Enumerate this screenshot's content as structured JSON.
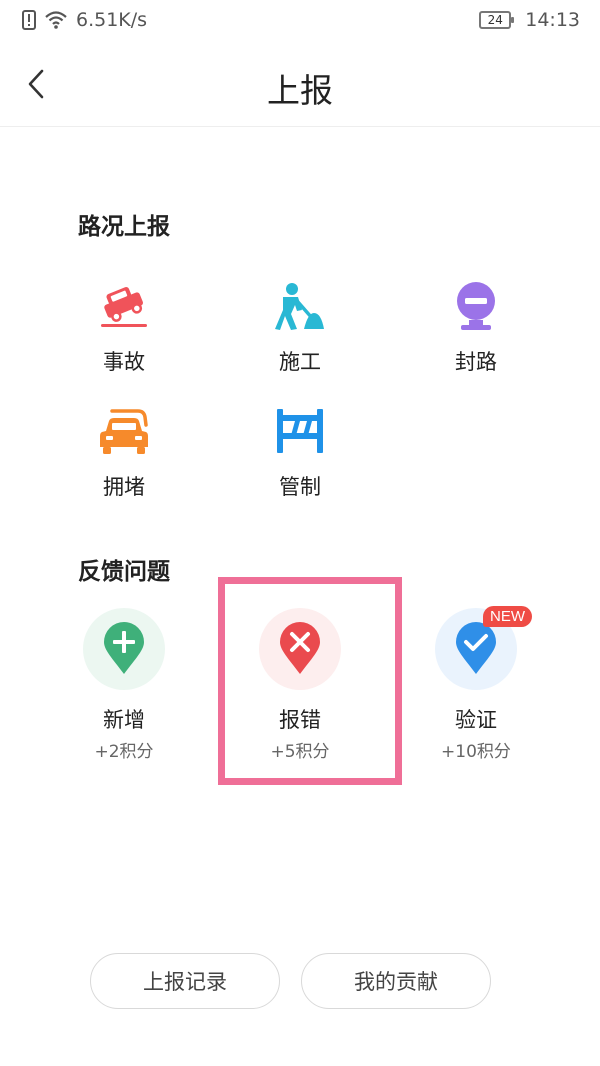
{
  "status_bar": {
    "net_speed": "6.51K/s",
    "battery": "24",
    "time": "14:13"
  },
  "header": {
    "title": "上报",
    "back_icon": "chevron-left-icon"
  },
  "road_report": {
    "title": "路况上报",
    "items": [
      {
        "label": "事故",
        "icon": "accident-icon",
        "color": "#f0535a"
      },
      {
        "label": "施工",
        "icon": "construction-icon",
        "color": "#29b8d4"
      },
      {
        "label": "封路",
        "icon": "road-closed-icon",
        "color": "#9b73e8"
      },
      {
        "label": "拥堵",
        "icon": "traffic-jam-icon",
        "color": "#f68a2b"
      },
      {
        "label": "管制",
        "icon": "control-barrier-icon",
        "color": "#1f92e8"
      }
    ]
  },
  "feedback": {
    "title": "反馈问题",
    "items": [
      {
        "label": "新增",
        "points": "+2积分",
        "icon": "add-pin-icon",
        "color": "#3fb07a"
      },
      {
        "label": "报错",
        "points": "+5积分",
        "icon": "error-pin-icon",
        "color": "#ea4a4e"
      },
      {
        "label": "验证",
        "points": "+10积分",
        "icon": "verify-pin-icon",
        "color": "#2f8fe8",
        "badge": "NEW"
      }
    ]
  },
  "bottom": {
    "records": "上报记录",
    "contribution": "我的贡献"
  }
}
